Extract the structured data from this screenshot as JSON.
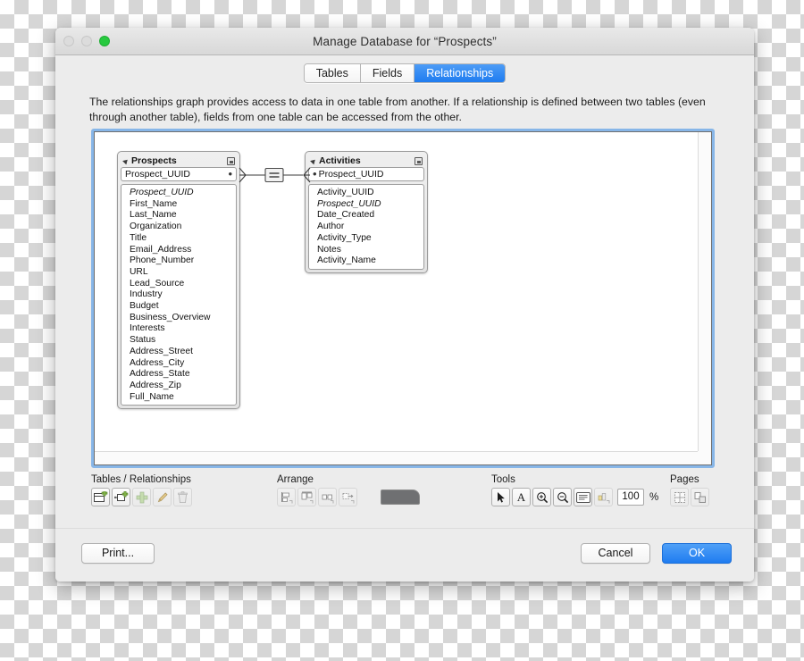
{
  "window": {
    "title": "Manage Database for “Prospects”",
    "traffic_lights": [
      "close",
      "minimize",
      "zoom"
    ],
    "accent_color": "#1f7cf0"
  },
  "tabs": [
    {
      "label": "Tables",
      "active": false
    },
    {
      "label": "Fields",
      "active": false
    },
    {
      "label": "Relationships",
      "active": true
    }
  ],
  "description": "The relationships graph provides access to data in one table from another. If a relationship is defined between two tables (even through another table), fields from one table can be accessed from the other.",
  "graph": {
    "tables": [
      {
        "name": "Prospects",
        "key_field": "Prospect_UUID",
        "key_bullet_side": "right",
        "fields": [
          {
            "name": "Prospect_UUID",
            "italic": true
          },
          {
            "name": "First_Name",
            "italic": false
          },
          {
            "name": "Last_Name",
            "italic": false
          },
          {
            "name": "Organization",
            "italic": false
          },
          {
            "name": "Title",
            "italic": false
          },
          {
            "name": "Email_Address",
            "italic": false
          },
          {
            "name": "Phone_Number",
            "italic": false
          },
          {
            "name": "URL",
            "italic": false
          },
          {
            "name": "Lead_Source",
            "italic": false
          },
          {
            "name": "Industry",
            "italic": false
          },
          {
            "name": "Budget",
            "italic": false
          },
          {
            "name": "Business_Overview",
            "italic": false
          },
          {
            "name": "Interests",
            "italic": false
          },
          {
            "name": "Status",
            "italic": false
          },
          {
            "name": "Address_Street",
            "italic": false
          },
          {
            "name": "Address_City",
            "italic": false
          },
          {
            "name": "Address_State",
            "italic": false
          },
          {
            "name": "Address_Zip",
            "italic": false
          },
          {
            "name": "Full_Name",
            "italic": false
          }
        ]
      },
      {
        "name": "Activities",
        "key_field": "Prospect_UUID",
        "key_bullet_side": "left",
        "fields": [
          {
            "name": "Activity_UUID",
            "italic": false
          },
          {
            "name": "Prospect_UUID",
            "italic": true
          },
          {
            "name": "Date_Created",
            "italic": false
          },
          {
            "name": "Author",
            "italic": false
          },
          {
            "name": "Activity_Type",
            "italic": false
          },
          {
            "name": "Notes",
            "italic": false
          },
          {
            "name": "Activity_Name",
            "italic": false
          }
        ]
      }
    ],
    "relationship": {
      "operator": "=",
      "left_table": "Prospects",
      "right_table": "Activities",
      "left_cardinality": "crowsfoot",
      "right_cardinality": "crowsfoot"
    }
  },
  "toolbar": {
    "groups": [
      {
        "label": "Tables / Relationships",
        "buttons": [
          {
            "icon": "add-table-icon",
            "enabled": true
          },
          {
            "icon": "add-relationship-icon",
            "enabled": true
          },
          {
            "icon": "duplicate-icon",
            "enabled": false
          },
          {
            "icon": "edit-pencil-icon",
            "enabled": false
          },
          {
            "icon": "delete-trash-icon",
            "enabled": false
          }
        ]
      },
      {
        "label": "Arrange",
        "buttons": [
          {
            "icon": "align-icon",
            "enabled": false
          },
          {
            "icon": "distribute-icon",
            "enabled": false
          },
          {
            "icon": "resize-icon",
            "enabled": false
          },
          {
            "icon": "select-related-icon",
            "enabled": false
          }
        ]
      },
      {
        "label": "Tools",
        "buttons": [
          {
            "icon": "selection-arrow-icon",
            "enabled": true
          },
          {
            "icon": "text-tool-icon",
            "enabled": true
          },
          {
            "icon": "zoom-in-icon",
            "enabled": true
          },
          {
            "icon": "zoom-out-icon",
            "enabled": true
          },
          {
            "icon": "note-icon",
            "enabled": true
          },
          {
            "icon": "color-object-icon",
            "enabled": false
          }
        ]
      },
      {
        "label": "Pages",
        "buttons": [
          {
            "icon": "page-breaks-icon",
            "enabled": false
          },
          {
            "icon": "page-setup-icon",
            "enabled": false
          }
        ]
      }
    ],
    "color_swatch": "#6f7072",
    "zoom_value": "100",
    "zoom_unit": "%"
  },
  "footer": {
    "print_label": "Print...",
    "cancel_label": "Cancel",
    "ok_label": "OK"
  }
}
